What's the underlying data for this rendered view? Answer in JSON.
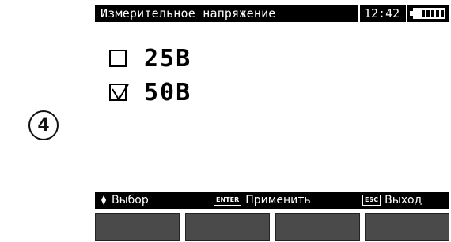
{
  "step_marker": "4",
  "titlebar": {
    "title": "Измерительное напряжение",
    "time": "12:42",
    "battery_icon": "battery-full-icon"
  },
  "options": [
    {
      "label": "25В",
      "checked": false
    },
    {
      "label": "50В",
      "checked": true
    }
  ],
  "footer": {
    "select_label": "Выбор",
    "enter_key": "ENTER",
    "apply_label": "Применить",
    "esc_key": "ESC",
    "exit_label": "Выход"
  },
  "softkeys": [
    "",
    "",
    "",
    ""
  ]
}
